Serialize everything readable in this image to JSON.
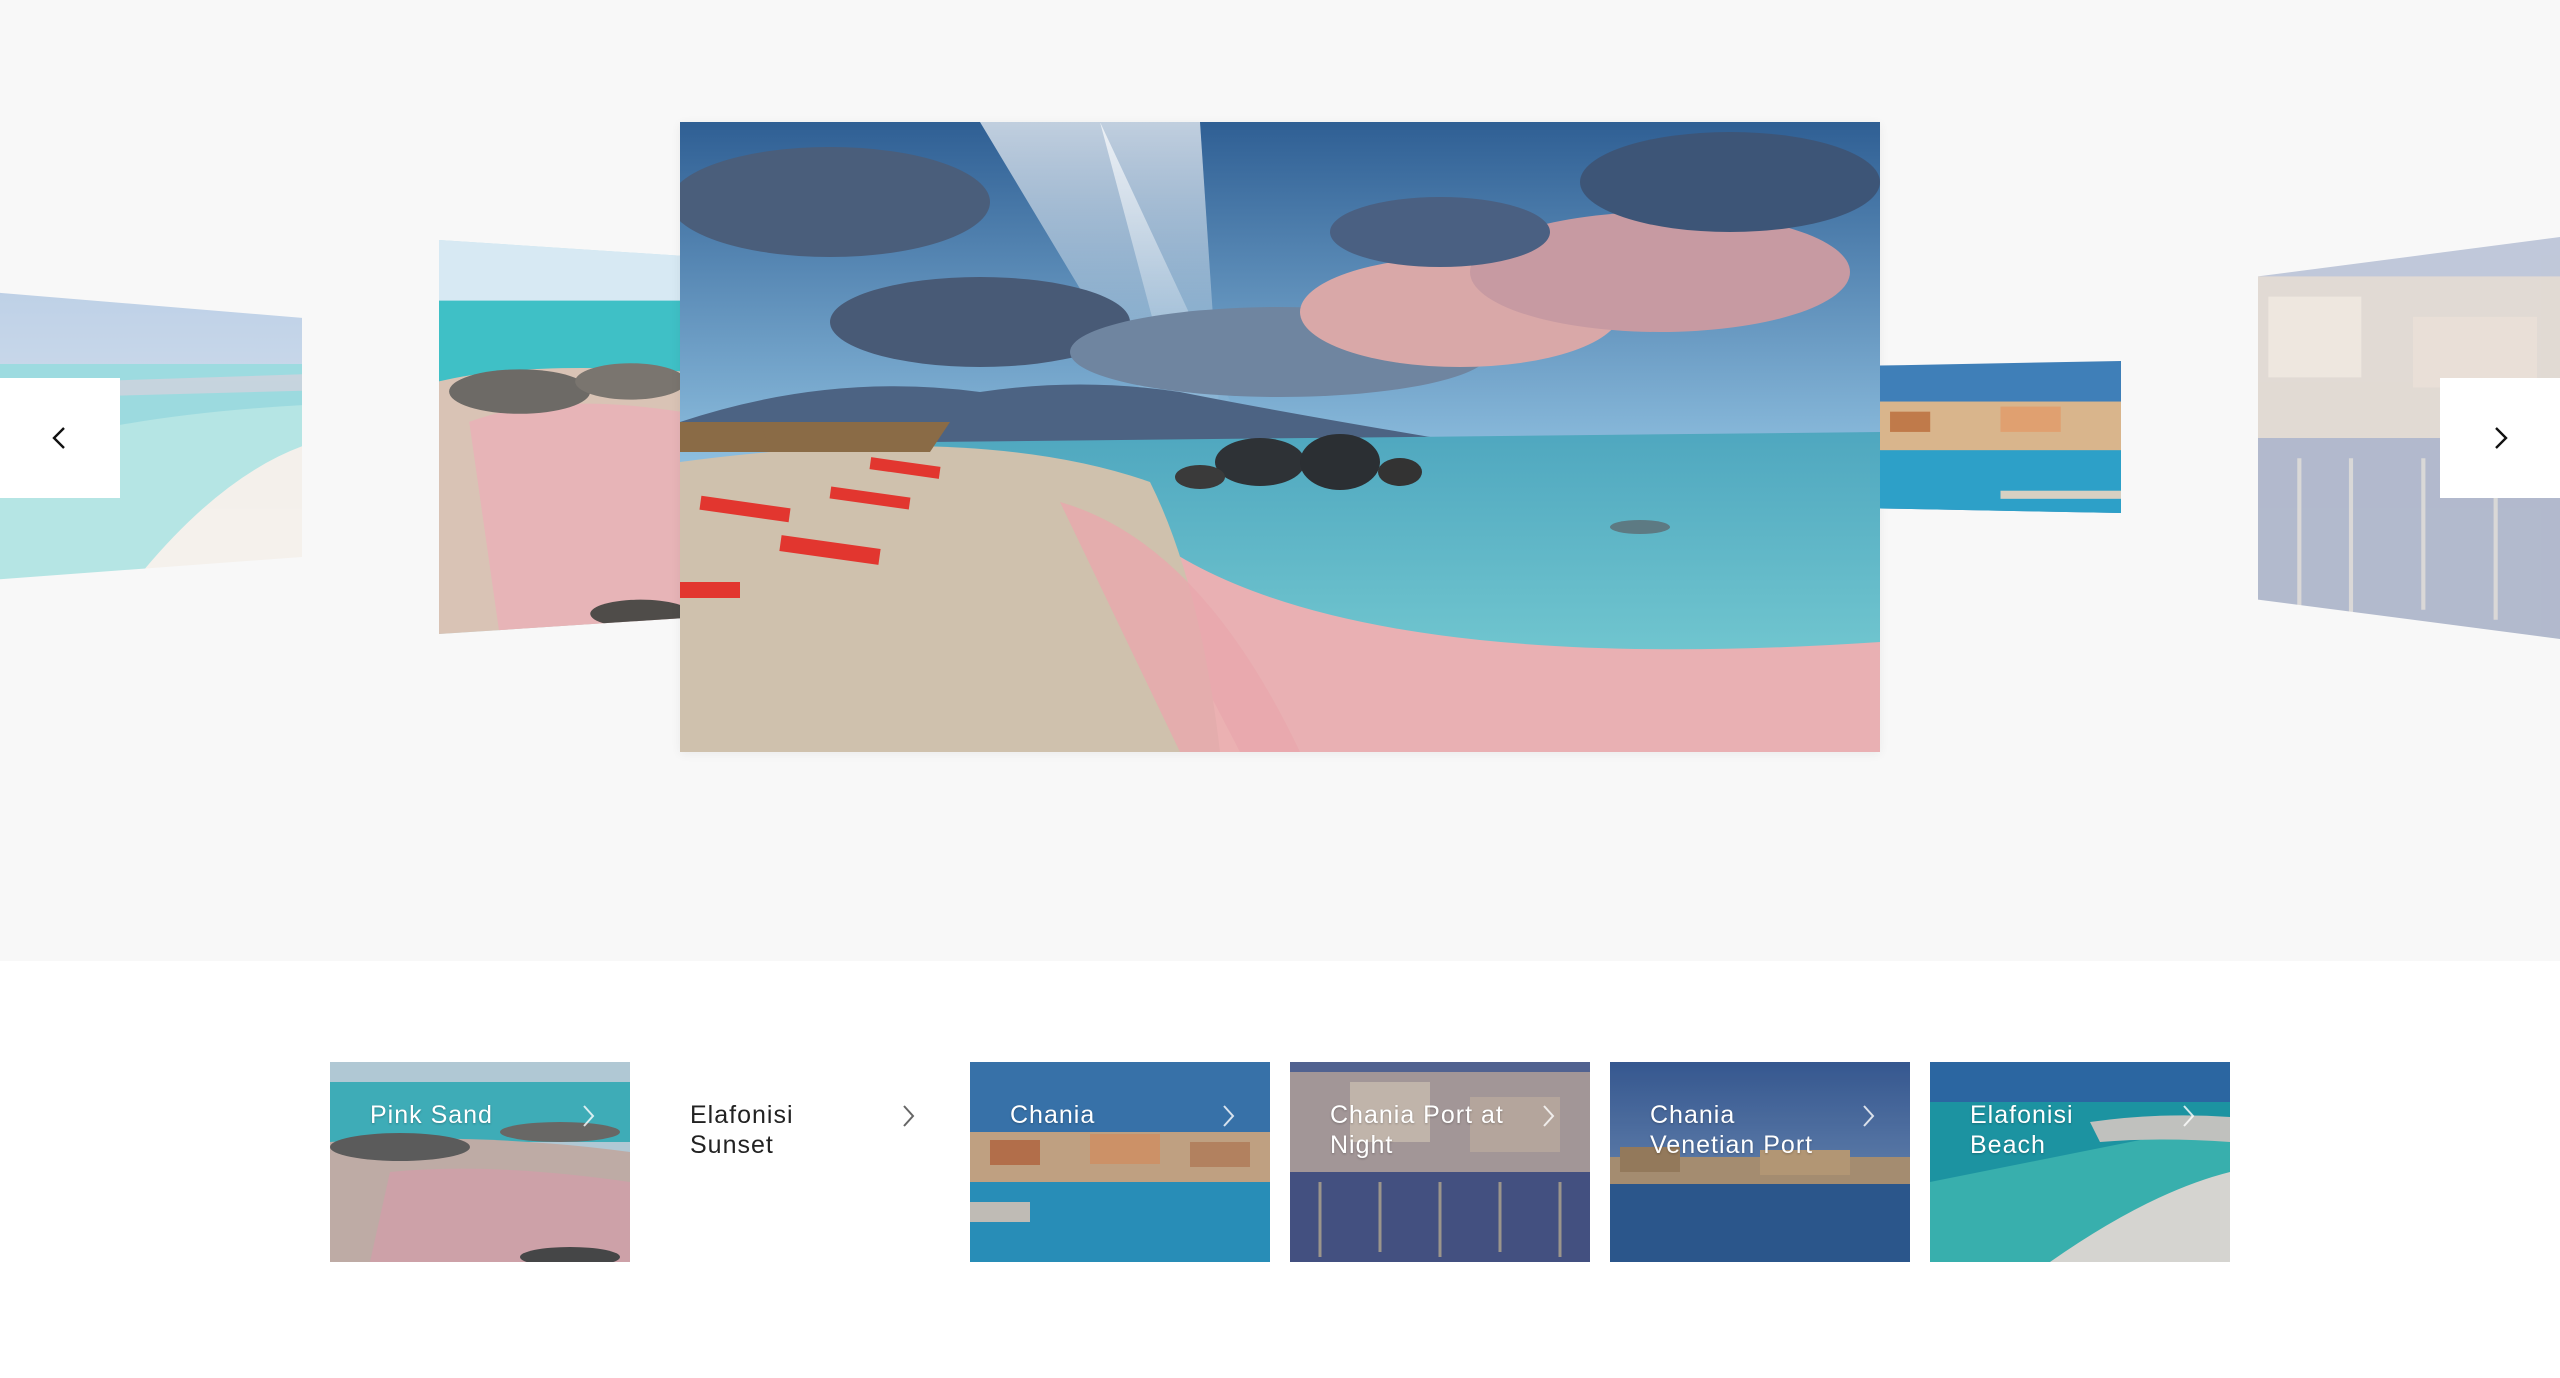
{
  "carousel": {
    "prev_icon": "chevron-left-icon",
    "next_icon": "chevron-right-icon",
    "slides": [
      {
        "name": "Elafonisi Beach"
      },
      {
        "name": "Pink Sand"
      },
      {
        "name": "Elafonisi Sunset"
      },
      {
        "name": "Chania"
      },
      {
        "name": "Chania Port at Night"
      }
    ]
  },
  "thumbnails": [
    {
      "label": "Pink Sand",
      "icon": "chevron-right-icon"
    },
    {
      "label": "Elafonisi Sunset",
      "icon": "chevron-right-icon"
    },
    {
      "label": "Chania",
      "icon": "chevron-right-icon"
    },
    {
      "label": "Chania Port at Night",
      "icon": "chevron-right-icon"
    },
    {
      "label": "Chania Venetian Port",
      "icon": "chevron-right-icon"
    },
    {
      "label": "Elafonisi Beach",
      "icon": "chevron-right-icon"
    }
  ],
  "colors": {
    "stage_background": "#f8f8f8",
    "sea": "#3fb6c4",
    "pink_sand": "#e6a6ad",
    "sky": "#3a6c9e"
  }
}
